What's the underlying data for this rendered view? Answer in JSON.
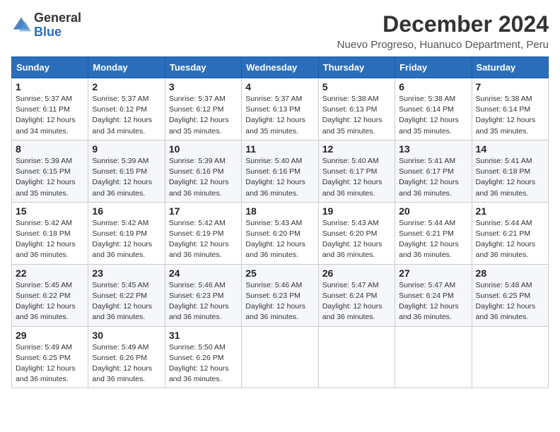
{
  "logo": {
    "general": "General",
    "blue": "Blue"
  },
  "title": "December 2024",
  "subtitle": "Nuevo Progreso, Huanuco Department, Peru",
  "weekdays": [
    "Sunday",
    "Monday",
    "Tuesday",
    "Wednesday",
    "Thursday",
    "Friday",
    "Saturday"
  ],
  "weeks": [
    [
      {
        "day": "1",
        "rise": "5:37 AM",
        "set": "6:11 PM",
        "daylight": "12 hours and 34 minutes."
      },
      {
        "day": "2",
        "rise": "5:37 AM",
        "set": "6:12 PM",
        "daylight": "12 hours and 34 minutes."
      },
      {
        "day": "3",
        "rise": "5:37 AM",
        "set": "6:12 PM",
        "daylight": "12 hours and 35 minutes."
      },
      {
        "day": "4",
        "rise": "5:37 AM",
        "set": "6:13 PM",
        "daylight": "12 hours and 35 minutes."
      },
      {
        "day": "5",
        "rise": "5:38 AM",
        "set": "6:13 PM",
        "daylight": "12 hours and 35 minutes."
      },
      {
        "day": "6",
        "rise": "5:38 AM",
        "set": "6:14 PM",
        "daylight": "12 hours and 35 minutes."
      },
      {
        "day": "7",
        "rise": "5:38 AM",
        "set": "6:14 PM",
        "daylight": "12 hours and 35 minutes."
      }
    ],
    [
      {
        "day": "8",
        "rise": "5:39 AM",
        "set": "6:15 PM",
        "daylight": "12 hours and 35 minutes."
      },
      {
        "day": "9",
        "rise": "5:39 AM",
        "set": "6:15 PM",
        "daylight": "12 hours and 36 minutes."
      },
      {
        "day": "10",
        "rise": "5:39 AM",
        "set": "6:16 PM",
        "daylight": "12 hours and 36 minutes."
      },
      {
        "day": "11",
        "rise": "5:40 AM",
        "set": "6:16 PM",
        "daylight": "12 hours and 36 minutes."
      },
      {
        "day": "12",
        "rise": "5:40 AM",
        "set": "6:17 PM",
        "daylight": "12 hours and 36 minutes."
      },
      {
        "day": "13",
        "rise": "5:41 AM",
        "set": "6:17 PM",
        "daylight": "12 hours and 36 minutes."
      },
      {
        "day": "14",
        "rise": "5:41 AM",
        "set": "6:18 PM",
        "daylight": "12 hours and 36 minutes."
      }
    ],
    [
      {
        "day": "15",
        "rise": "5:42 AM",
        "set": "6:18 PM",
        "daylight": "12 hours and 36 minutes."
      },
      {
        "day": "16",
        "rise": "5:42 AM",
        "set": "6:19 PM",
        "daylight": "12 hours and 36 minutes."
      },
      {
        "day": "17",
        "rise": "5:42 AM",
        "set": "6:19 PM",
        "daylight": "12 hours and 36 minutes."
      },
      {
        "day": "18",
        "rise": "5:43 AM",
        "set": "6:20 PM",
        "daylight": "12 hours and 36 minutes."
      },
      {
        "day": "19",
        "rise": "5:43 AM",
        "set": "6:20 PM",
        "daylight": "12 hours and 36 minutes."
      },
      {
        "day": "20",
        "rise": "5:44 AM",
        "set": "6:21 PM",
        "daylight": "12 hours and 36 minutes."
      },
      {
        "day": "21",
        "rise": "5:44 AM",
        "set": "6:21 PM",
        "daylight": "12 hours and 36 minutes."
      }
    ],
    [
      {
        "day": "22",
        "rise": "5:45 AM",
        "set": "6:22 PM",
        "daylight": "12 hours and 36 minutes."
      },
      {
        "day": "23",
        "rise": "5:45 AM",
        "set": "6:22 PM",
        "daylight": "12 hours and 36 minutes."
      },
      {
        "day": "24",
        "rise": "5:46 AM",
        "set": "6:23 PM",
        "daylight": "12 hours and 36 minutes."
      },
      {
        "day": "25",
        "rise": "5:46 AM",
        "set": "6:23 PM",
        "daylight": "12 hours and 36 minutes."
      },
      {
        "day": "26",
        "rise": "5:47 AM",
        "set": "6:24 PM",
        "daylight": "12 hours and 36 minutes."
      },
      {
        "day": "27",
        "rise": "5:47 AM",
        "set": "6:24 PM",
        "daylight": "12 hours and 36 minutes."
      },
      {
        "day": "28",
        "rise": "5:48 AM",
        "set": "6:25 PM",
        "daylight": "12 hours and 36 minutes."
      }
    ],
    [
      {
        "day": "29",
        "rise": "5:49 AM",
        "set": "6:25 PM",
        "daylight": "12 hours and 36 minutes."
      },
      {
        "day": "30",
        "rise": "5:49 AM",
        "set": "6:26 PM",
        "daylight": "12 hours and 36 minutes."
      },
      {
        "day": "31",
        "rise": "5:50 AM",
        "set": "6:26 PM",
        "daylight": "12 hours and 36 minutes."
      },
      null,
      null,
      null,
      null
    ]
  ]
}
